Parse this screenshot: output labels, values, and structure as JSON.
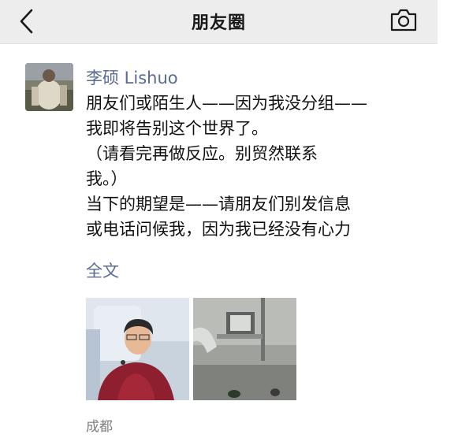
{
  "navbar": {
    "title": "朋友圈",
    "back_icon": "chevron-left-icon",
    "camera_icon": "camera-icon"
  },
  "post": {
    "author": "李硕 Lishuo",
    "lines": [
      "朋友们或陌生人——因为我没分组——",
      "我即将告别这个世界了。",
      "（请看完再做反应。别贸然联系",
      "我。）",
      "当下的期望是——请朋友们别发信息",
      "或电话问候我，因为我已经没有心力"
    ],
    "full_text_link": "全文",
    "location": "成都"
  },
  "colors": {
    "navbar_bg": "#ededed",
    "link": "#576b95",
    "text": "#111111",
    "meta": "#7f7f7f"
  }
}
